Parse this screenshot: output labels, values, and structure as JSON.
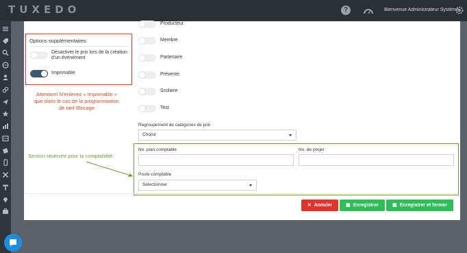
{
  "header": {
    "logo_text": "TUXEDO",
    "welcome_text": "Bienvenue Administrateur Système",
    "icons": [
      "help-icon",
      "gauge-icon",
      "gear-icon"
    ]
  },
  "sidebar": {
    "icons": [
      "menu-icon",
      "tag-icon",
      "search-icon",
      "globe-icon",
      "users-icon",
      "link-icon",
      "send-icon",
      "star-icon",
      "chart-icon",
      "table-icon",
      "ticket-icon",
      "mobile-icon",
      "tools-icon",
      "hammer-icon",
      "map-pin-icon",
      "briefcase-icon"
    ]
  },
  "options": {
    "title": "Options supplémentaires",
    "toggles": [
      {
        "label": "Désactiver le prix lors de la création d'un événement",
        "on": false
      },
      {
        "label": "Imprimable",
        "on": true
      }
    ]
  },
  "roles": [
    {
      "label": "Producteur",
      "on": false
    },
    {
      "label": "Membre",
      "on": false
    },
    {
      "label": "Partenaire",
      "on": false
    },
    {
      "label": "Prévente",
      "on": false
    },
    {
      "label": "Scolaire",
      "on": false
    },
    {
      "label": "Test",
      "on": false
    }
  ],
  "annotations": {
    "attention": "Attention! N'enlevez « Imprimable » que dans le cas de la programmation de tarif Blocage",
    "section_note": "Section réservée pour la comptabilité"
  },
  "price_group": {
    "label": "Regroupement de catégories de prix",
    "value": "Choisir"
  },
  "accounting": {
    "plan_label": "No. plan comptable",
    "plan_value": "",
    "project_label": "No. de projet",
    "project_value": "",
    "post_label": "Poste comptable",
    "post_value": "Sélectionner"
  },
  "buttons": {
    "cancel": "Annuler",
    "save": "Enregistrer",
    "save_close": "Enregistrer et fermer"
  },
  "colors": {
    "accent_red": "#e0342b",
    "accent_green": "#2ebd58",
    "note_green": "#6aa039",
    "toggle_on": "#3d5a6c"
  }
}
